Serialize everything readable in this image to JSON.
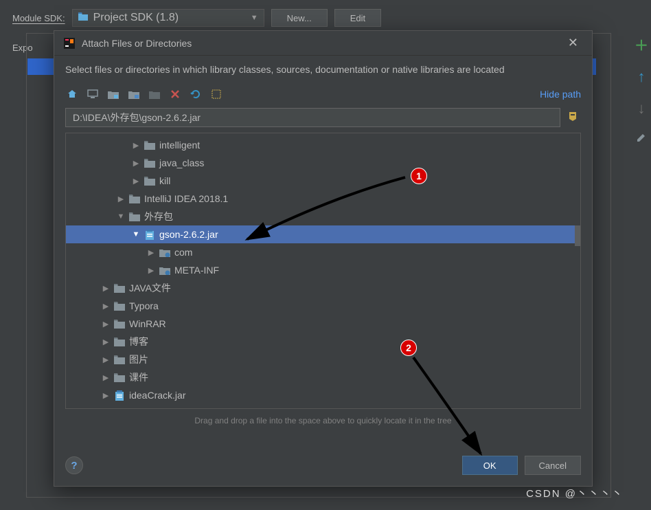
{
  "sdk": {
    "label": "Module SDK:",
    "value": "Project SDK (1.8)",
    "new_btn": "New...",
    "edit_btn": "Edit"
  },
  "export_label": "Expo",
  "dialog": {
    "title": "Attach Files or Directories",
    "instruction": "Select files or directories in which library classes, sources, documentation or native libraries are located",
    "hide_path": "Hide path",
    "path_value": "D:\\IDEA\\外存包\\gson-2.6.2.jar",
    "hint": "Drag and drop a file into the space above to quickly locate it in the tree",
    "ok": "OK",
    "cancel": "Cancel"
  },
  "toolbar_icons": [
    "home",
    "desktop",
    "project",
    "module",
    "new-folder",
    "delete",
    "refresh",
    "show-hidden"
  ],
  "tree": [
    {
      "indent": 3,
      "chev": "right",
      "icon": "folder",
      "label": "intelligent"
    },
    {
      "indent": 3,
      "chev": "right",
      "icon": "folder",
      "label": "java_class"
    },
    {
      "indent": 3,
      "chev": "right",
      "icon": "folder",
      "label": "kill"
    },
    {
      "indent": 2,
      "chev": "right",
      "icon": "folder",
      "label": "IntelliJ IDEA 2018.1"
    },
    {
      "indent": 2,
      "chev": "down",
      "icon": "folder",
      "label": "外存包"
    },
    {
      "indent": 3,
      "chev": "down",
      "icon": "jar",
      "label": "gson-2.6.2.jar",
      "selected": true
    },
    {
      "indent": 4,
      "chev": "right",
      "icon": "pkg",
      "label": "com"
    },
    {
      "indent": 4,
      "chev": "right",
      "icon": "pkg",
      "label": "META-INF"
    },
    {
      "indent": 1,
      "chev": "right",
      "icon": "folder",
      "label": "JAVA文件"
    },
    {
      "indent": 1,
      "chev": "right",
      "icon": "folder",
      "label": "Typora"
    },
    {
      "indent": 1,
      "chev": "right",
      "icon": "folder",
      "label": "WinRAR"
    },
    {
      "indent": 1,
      "chev": "right",
      "icon": "folder",
      "label": "博客"
    },
    {
      "indent": 1,
      "chev": "right",
      "icon": "folder",
      "label": "图片"
    },
    {
      "indent": 1,
      "chev": "right",
      "icon": "folder",
      "label": "课件"
    },
    {
      "indent": 1,
      "chev": "right",
      "icon": "jar",
      "label": "ideaCrack.jar"
    }
  ],
  "annotations": {
    "one": "1",
    "two": "2"
  },
  "watermark": "CSDN @丶丶丶丶"
}
